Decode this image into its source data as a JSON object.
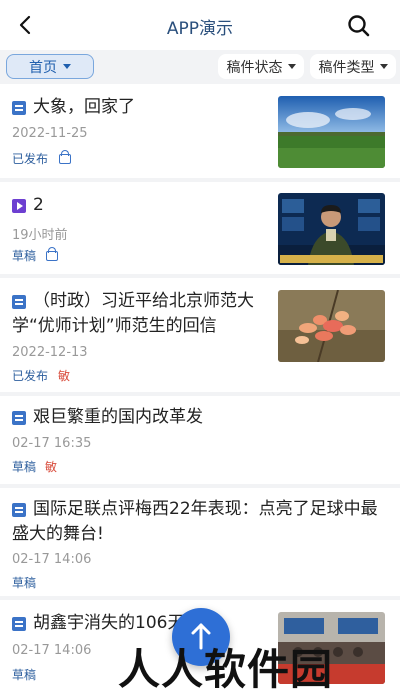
{
  "header": {
    "title": "APP演示",
    "back_icon": "back-arrow-icon",
    "search_icon": "search-icon"
  },
  "filters": {
    "home_label": "首页",
    "status_label": "稿件状态",
    "type_label": "稿件类型"
  },
  "articles": [
    {
      "title": "大象，回家了",
      "date": "2022-11-25",
      "status": "已发布",
      "type": "document",
      "locked": true,
      "sensitive": ""
    },
    {
      "title": "2",
      "date": "19小时前",
      "status": "草稿",
      "type": "video",
      "locked": true,
      "sensitive": ""
    },
    {
      "title_line1": "（时政）习近平给北京师范大",
      "title_line2": "学“优师计划”师范生的回信",
      "date": "2022-12-13",
      "status": "已发布",
      "type": "document",
      "locked": false,
      "sensitive": "敏"
    },
    {
      "title": "艰巨繁重的国内改革发",
      "date": "02-17 16:35",
      "status": "草稿",
      "type": "document",
      "locked": false,
      "sensitive": "敏"
    },
    {
      "title_line1": "国际足联点评梅西22年表现：点亮了足球中最",
      "title_line2": "盛大的舞台!",
      "date": "02-17 14:06",
      "status": "草稿",
      "type": "document",
      "locked": false,
      "sensitive": ""
    },
    {
      "title": "胡鑫宇消失的106天",
      "date": "02-17 14:06",
      "status": "草稿",
      "type": "document",
      "locked": false,
      "sensitive": ""
    }
  ],
  "fab_icon": "upload-arrow-icon",
  "watermark": "人人软件园",
  "colors": {
    "accent": "#2e6fd6",
    "title": "#2a4f7c",
    "status": "#2e5f9e",
    "sensitive": "#d84a3a"
  }
}
